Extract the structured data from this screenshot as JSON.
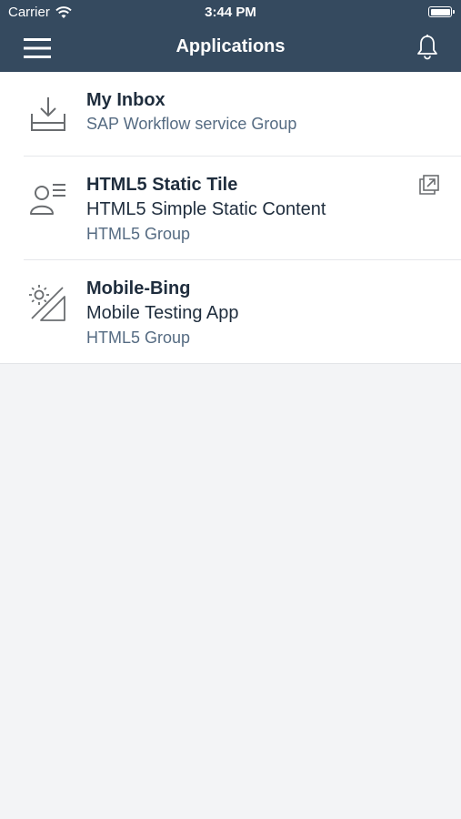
{
  "status_bar": {
    "carrier": "Carrier",
    "time": "3:44 PM",
    "wifi_icon": "wifi-icon",
    "battery_icon": "battery-icon"
  },
  "nav": {
    "title": "Applications",
    "menu_icon": "hamburger-menu-icon",
    "bell_icon": "bell-icon"
  },
  "colors": {
    "header_bg": "#354a5f",
    "background": "#f3f4f6",
    "text": "#1f2d3d",
    "secondary_text": "#556b82",
    "icon": "#6a6d70"
  },
  "apps": [
    {
      "title": "My Inbox",
      "subtitle": "",
      "group": "SAP Workflow service Group",
      "icon": "inbox-download-icon"
    },
    {
      "title": "HTML5 Static Tile",
      "subtitle": "HTML5 Simple Static Content",
      "group": "HTML5 Group",
      "icon": "person-list-icon",
      "action_icon": "external-link-icon"
    },
    {
      "title": "Mobile-Bing",
      "subtitle": "Mobile Testing App",
      "group": "HTML5 Group",
      "icon": "brightness-contrast-icon"
    }
  ]
}
